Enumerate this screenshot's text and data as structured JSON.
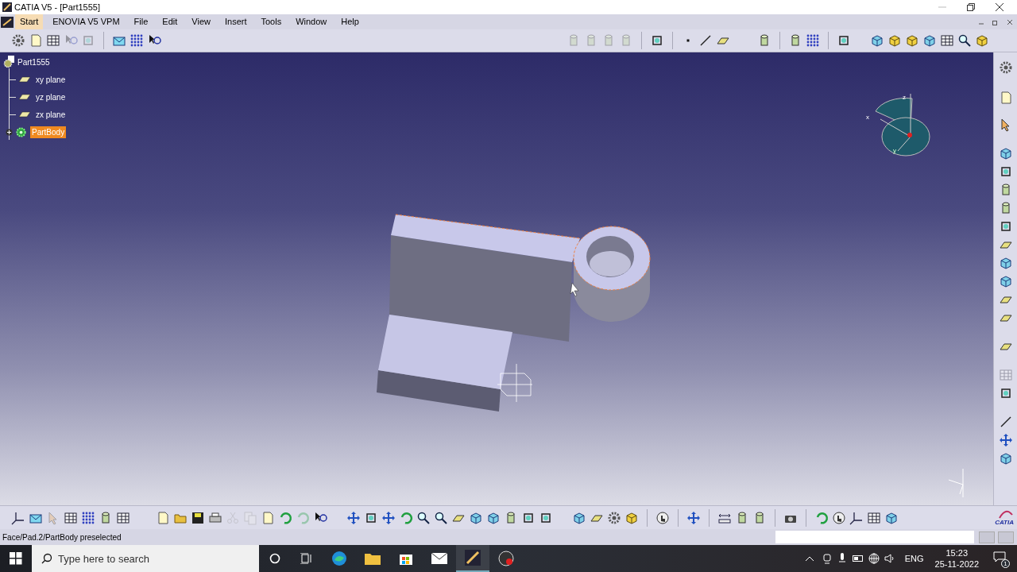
{
  "window": {
    "title": "CATIA V5 - [Part1555]"
  },
  "menu": [
    {
      "label": "Start",
      "selected": true
    },
    {
      "label": "ENOVIA V5 VPM",
      "selected": false
    },
    {
      "label": "File",
      "selected": false
    },
    {
      "label": "Edit",
      "selected": false
    },
    {
      "label": "View",
      "selected": false
    },
    {
      "label": "Insert",
      "selected": false
    },
    {
      "label": "Tools",
      "selected": false
    },
    {
      "label": "Window",
      "selected": false
    },
    {
      "label": "Help",
      "selected": false
    }
  ],
  "tree": {
    "label": "Part1555",
    "children": [
      {
        "label": "xy plane",
        "kind": "plane",
        "selected": false
      },
      {
        "label": "yz plane",
        "kind": "plane",
        "selected": false
      },
      {
        "label": "zx plane",
        "kind": "plane",
        "selected": false
      },
      {
        "label": "PartBody",
        "kind": "body",
        "selected": true
      }
    ]
  },
  "compass": {
    "labels": [
      "x",
      "y",
      "z"
    ]
  },
  "logo": {
    "text": "CATIA"
  },
  "status_bar": {
    "message": "Face/Pad.2/PartBody preselected"
  },
  "taskbar": {
    "search_placeholder": "Type here to search",
    "language": "ENG",
    "time": "15:23",
    "date": "25-11-2022",
    "notifications": "1"
  }
}
